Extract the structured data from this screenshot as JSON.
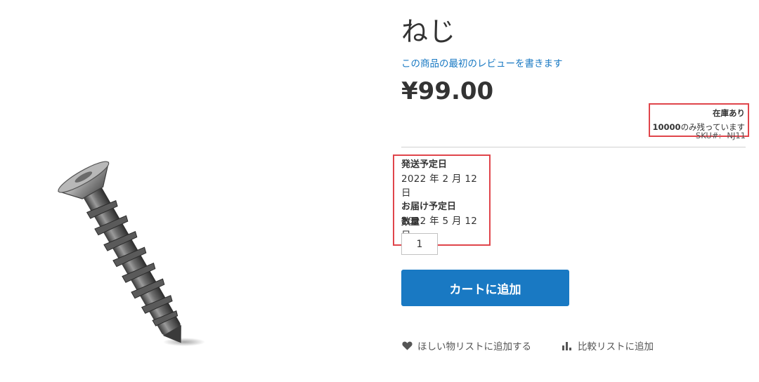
{
  "product": {
    "title": "ねじ",
    "review_link": "この商品の最初のレビューを書きます",
    "price": "¥99.00",
    "stock_status": "在庫あり",
    "stock_qty": "10000",
    "stock_remaining_suffix": "のみ残っています",
    "sku_label": "SKU#:",
    "sku_value": "NJ11"
  },
  "shipping": {
    "ship_heading": "発送予定日",
    "ship_date": "2022 年 2 月 12 日",
    "delivery_heading": "お届け予定日",
    "delivery_date": "2022 年 5 月 12 日"
  },
  "quantity": {
    "label": "数量",
    "value": "1"
  },
  "actions": {
    "add_to_cart": "カートに追加",
    "wishlist": "ほしい物リストに追加する",
    "compare": "比較リストに追加"
  },
  "icons": {
    "wishlist": "heart-icon",
    "compare": "bar-chart-icon"
  },
  "colors": {
    "accent": "#1979c3",
    "highlight_border": "#e0454b"
  }
}
